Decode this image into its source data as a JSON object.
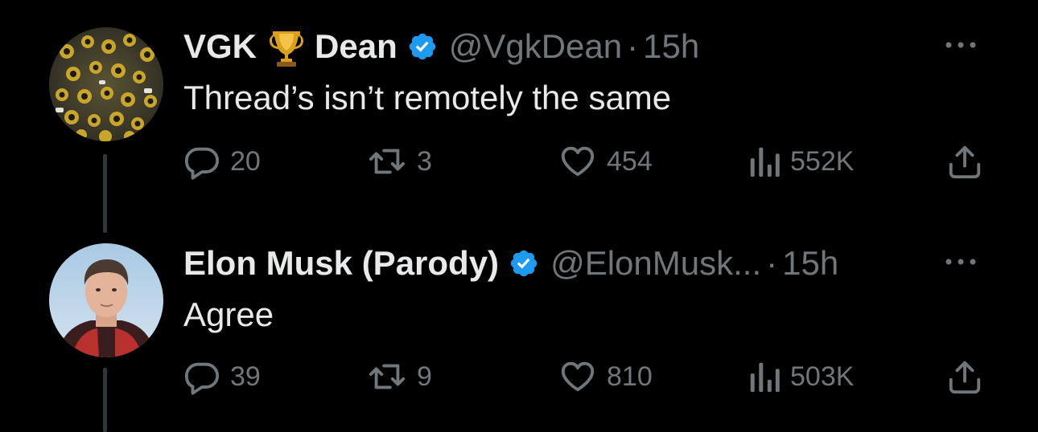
{
  "colors": {
    "background": "#000000",
    "primary_text": "#e7e9ea",
    "secondary_text": "#71767b",
    "verified": "#1d9bf0",
    "thread_line": "#333639"
  },
  "tweets": [
    {
      "display_name_first": "VGK",
      "name_emoji": "trophy-icon",
      "display_name_last": "Dean",
      "verified": true,
      "handle": "@VgkDean",
      "separator": "·",
      "time": "15h",
      "text": "Thread’s isn’t remotely the same",
      "replies": "20",
      "retweets": "3",
      "likes": "454",
      "views": "552K"
    },
    {
      "display_name": "Elon Musk (Parody)",
      "verified": true,
      "handle": "@ElonMusk...",
      "separator": "·",
      "time": "15h",
      "text": "Agree",
      "replies": "39",
      "retweets": "9",
      "likes": "810",
      "views": "503K"
    }
  ],
  "icons": {
    "reply": "reply-icon",
    "retweet": "retweet-icon",
    "like": "heart-icon",
    "views": "views-icon",
    "share": "share-icon",
    "more": "more-icon",
    "verified": "verified-badge-icon"
  }
}
